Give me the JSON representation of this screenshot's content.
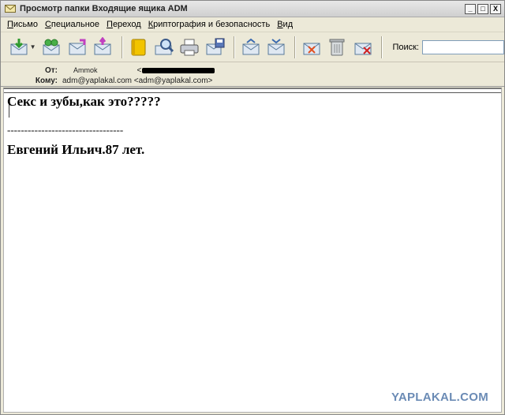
{
  "window": {
    "title": "Просмотр папки Входящие ящика ADM",
    "controls": {
      "minimize": "_",
      "maximize": "□",
      "close": "X"
    }
  },
  "menu": {
    "items": [
      {
        "label": "Письмо",
        "underline": "П",
        "rest": "исьмо"
      },
      {
        "label": "Специальное",
        "underline": "С",
        "rest": "пециальное"
      },
      {
        "label": "Переход",
        "underline": "П",
        "rest": "ереход"
      },
      {
        "label": "Криптография и безопасность",
        "underline": "К",
        "rest": "риптография и безопасность"
      },
      {
        "label": "Вид",
        "underline": "В",
        "rest": "ид"
      }
    ]
  },
  "toolbar": {
    "icons": [
      "get-mail-icon",
      "dropdown-arrow-icon",
      "new-message-icon",
      "reply-icon",
      "forward-icon",
      "address-book-icon",
      "find-icon",
      "print-icon",
      "save-icon",
      "previous-icon",
      "next-icon",
      "mark-unread-icon",
      "delete-icon",
      "junk-icon"
    ],
    "search_label": "Поиск:",
    "search_value": ""
  },
  "message": {
    "from_label": "От:",
    "from_name": "Ammok",
    "from_address_prefix": "<",
    "to_label": "Кому:",
    "to_value": "adm@yaplakal.com <adm@yaplakal.com>",
    "body_lines": [
      "Секс и зубы,как это?????",
      "----------------------------------",
      "Евгений Ильич.87 лет."
    ]
  },
  "watermark": "YAPLAKAL.COM",
  "colors": {
    "window_bg": "#ece9d8",
    "body_bg": "#ffffff",
    "watermark": "#6b8bb5"
  }
}
